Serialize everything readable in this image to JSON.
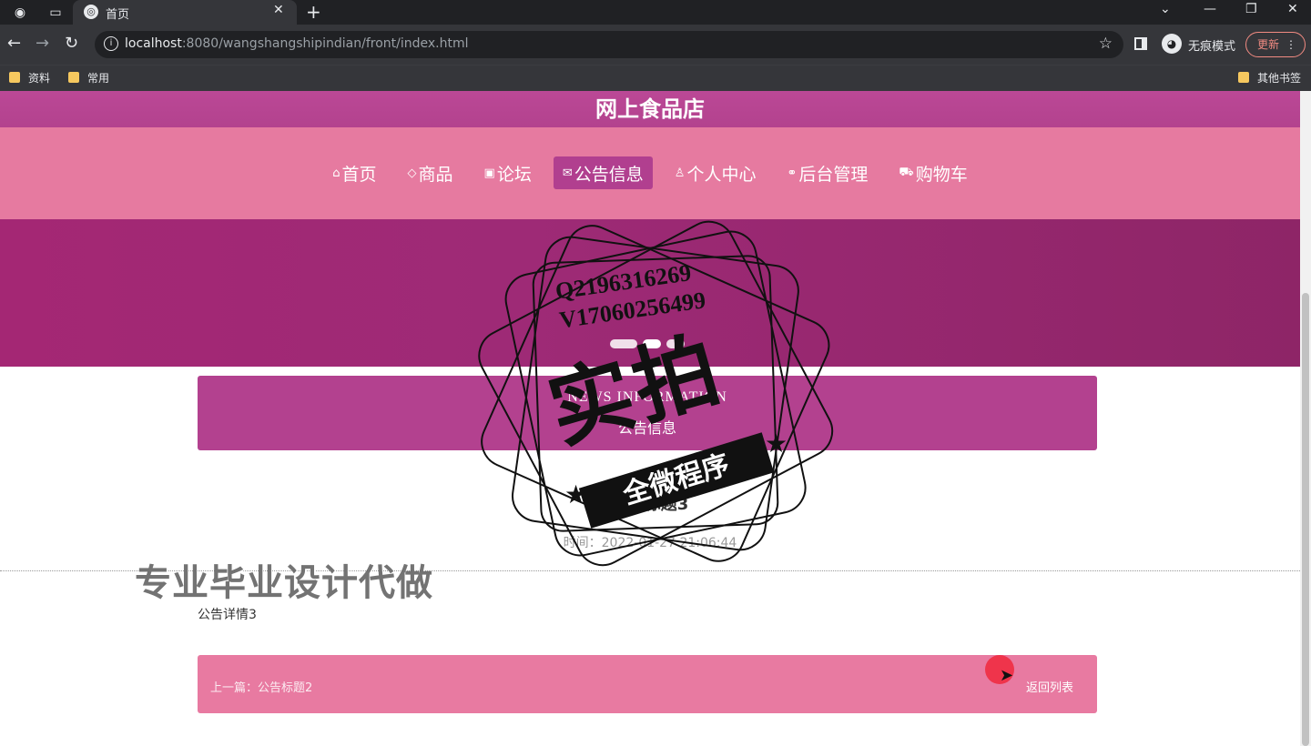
{
  "browser": {
    "tab_title": "首页",
    "new_tab": "+",
    "url_host": "localhost",
    "url_rest": ":8080/wangshangshipindian/front/index.html",
    "incognito_label": "无痕模式",
    "update_label": "更新",
    "bookmarks": [
      "资料",
      "常用"
    ],
    "other_bookmarks": "其他书签"
  },
  "site": {
    "title": "网上食品店",
    "nav": [
      {
        "label": "首页",
        "icon": "home-icon"
      },
      {
        "label": "商品",
        "icon": "tag-icon"
      },
      {
        "label": "论坛",
        "icon": "gift-icon"
      },
      {
        "label": "公告信息",
        "icon": "mail-icon",
        "active": true
      },
      {
        "label": "个人中心",
        "icon": "user-icon"
      },
      {
        "label": "后台管理",
        "icon": "link-icon"
      },
      {
        "label": "购物车",
        "icon": "cart-icon"
      }
    ],
    "accent_color": "#b3418f",
    "nav_color": "#e67aa0"
  },
  "news": {
    "heading_en": "NEWS INFORMATION",
    "heading_cn": "公告信息",
    "article_title": "公告标题3",
    "time": "时间：2022-01-27 21:06:44",
    "body": "公告详情3",
    "prev_label": "上一篇：公告标题2",
    "back_label": "返回列表"
  },
  "watermark": {
    "contact_q": "Q2196316269",
    "contact_v": "V17060256499",
    "stamp_big": "实拍",
    "stamp_ribbon": "全微程序",
    "side_text": "专业毕业设计代做"
  }
}
